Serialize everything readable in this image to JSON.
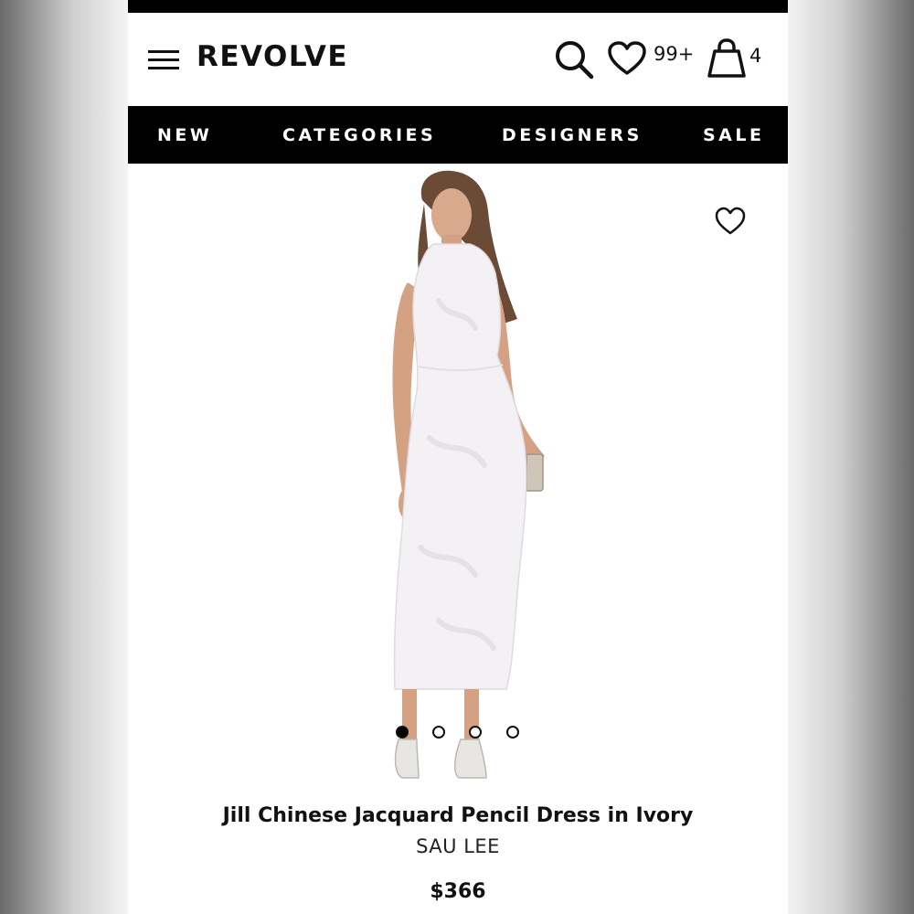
{
  "header": {
    "brand": "REVOLVE",
    "wishlist_count": "99+",
    "bag_count": "4"
  },
  "nav": {
    "items": [
      {
        "label": "NEW"
      },
      {
        "label": "CATEGORIES"
      },
      {
        "label": "DESIGNERS"
      },
      {
        "label": "SALE"
      }
    ]
  },
  "product": {
    "title": "Jill Chinese Jacquard Pencil Dress in Ivory",
    "designer": "SAU LEE",
    "price": "$366",
    "carousel": {
      "total": 4,
      "active_index": 0
    }
  },
  "icons": [
    "menu-icon",
    "search-icon",
    "heart-icon",
    "shopping-bag-icon",
    "favorite-heart-icon"
  ],
  "colors": {
    "header_bg": "#ffffff",
    "nav_bg": "#000000",
    "nav_text": "#ffffff",
    "text": "#111111"
  }
}
